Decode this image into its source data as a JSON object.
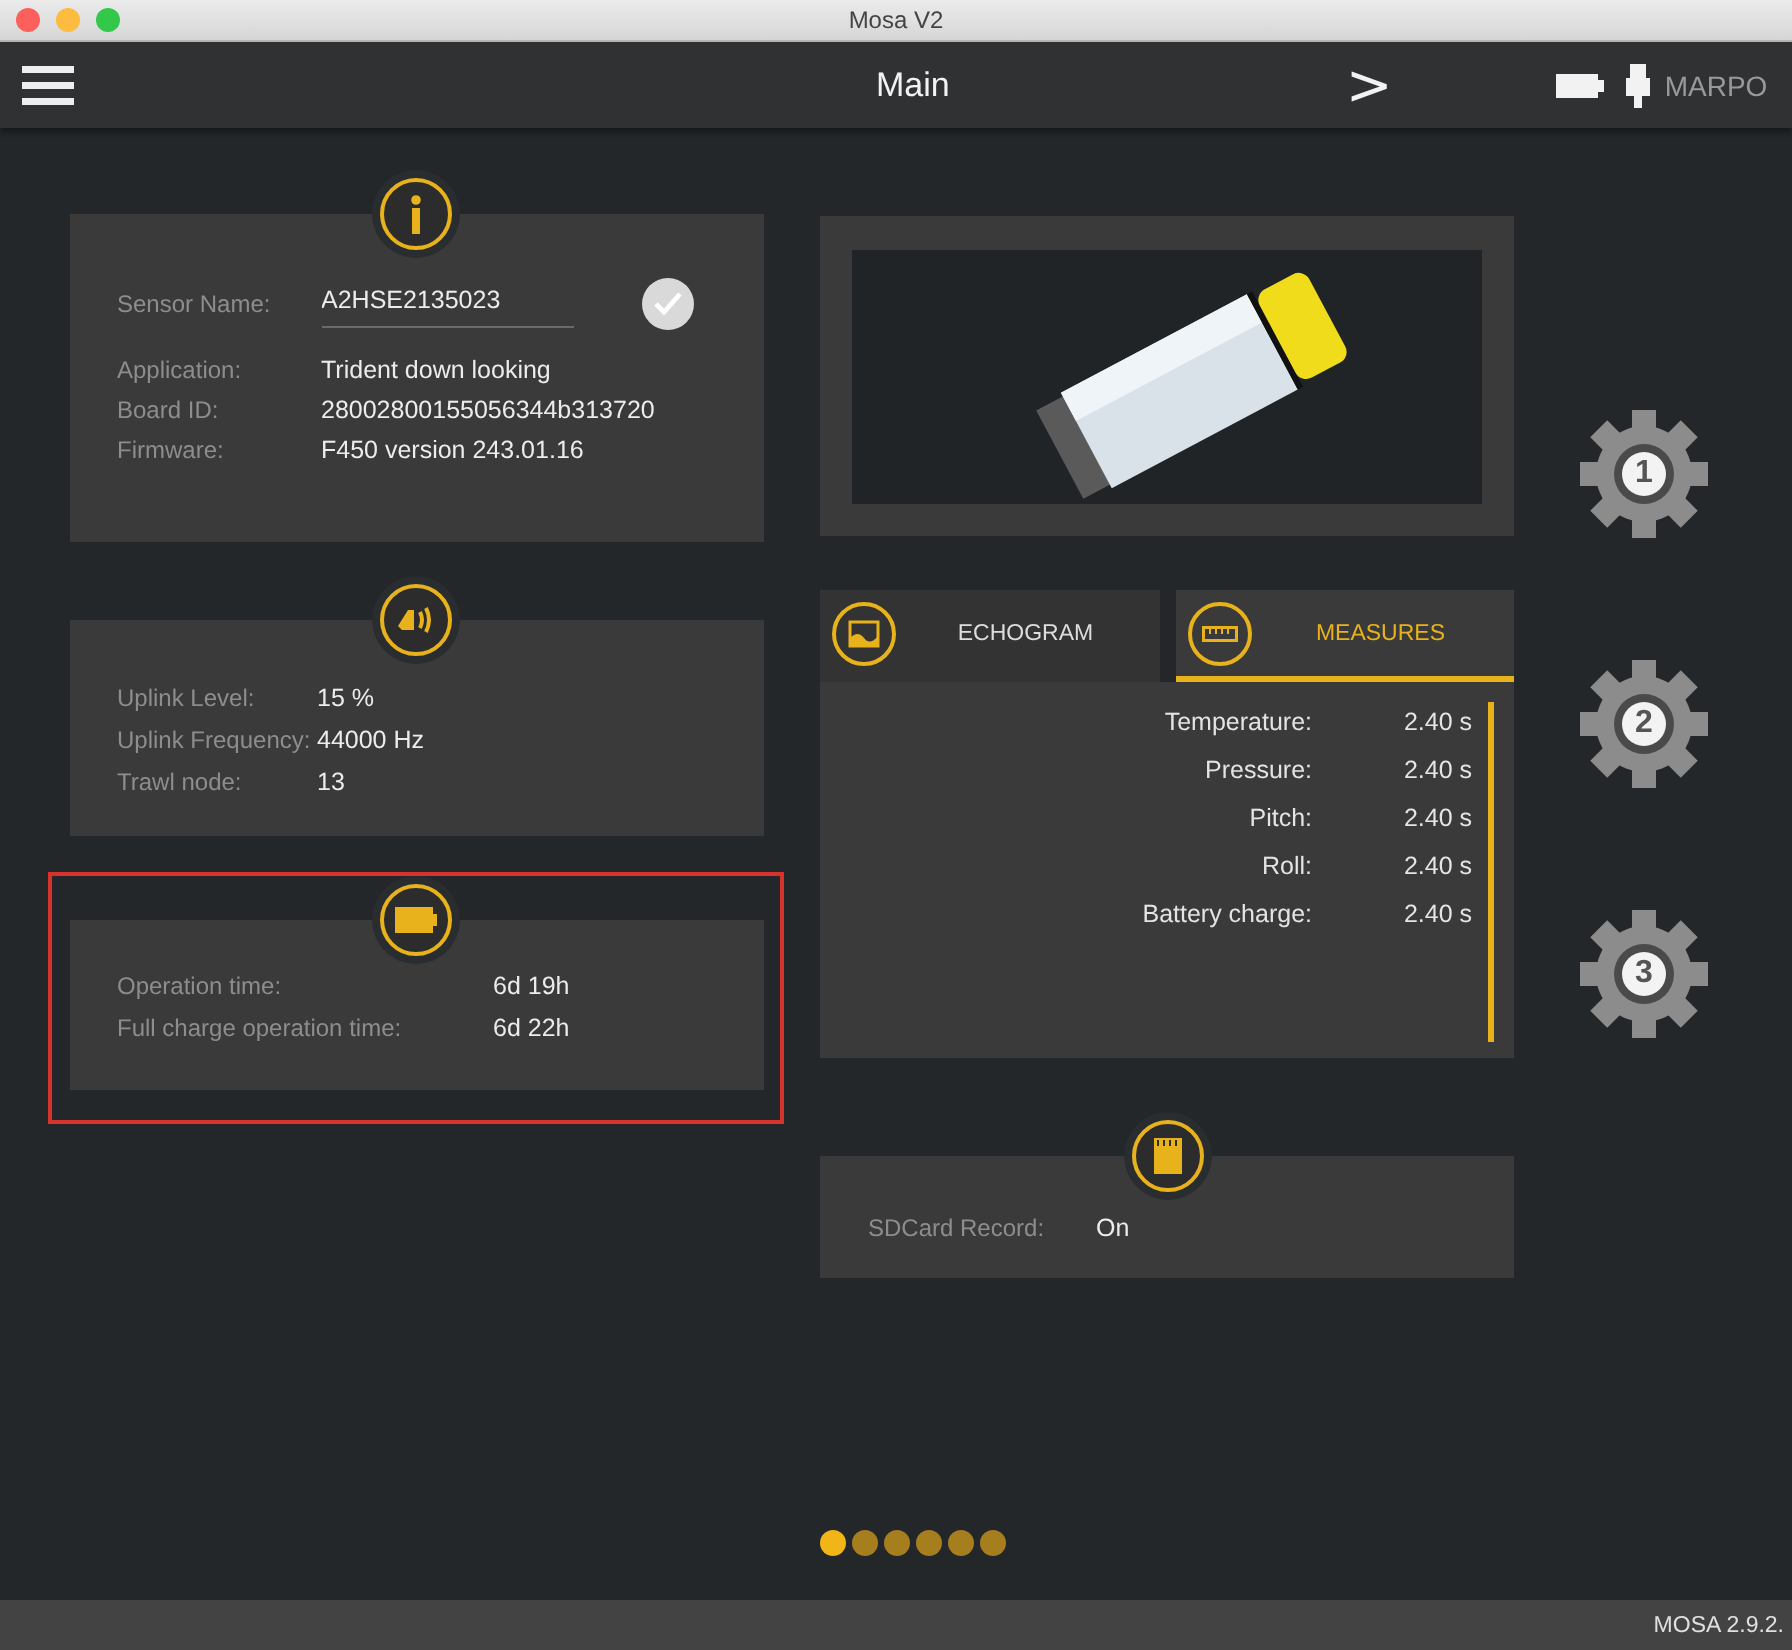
{
  "window": {
    "title": "Mosa V2"
  },
  "app_bar": {
    "title": "Main",
    "next": ">",
    "logo": "MARPO"
  },
  "info": {
    "sensor_name_label": "Sensor Name:",
    "sensor_name": "A2HSE2135023",
    "confirmed": true,
    "rows": [
      {
        "label": "Application:",
        "value": "Trident down looking"
      },
      {
        "label": "Board ID:",
        "value": "28002800155056344b313720"
      },
      {
        "label": "Firmware:",
        "value": "F450 version 243.01.16"
      }
    ]
  },
  "uplink": {
    "rows": [
      {
        "label": "Uplink Level:",
        "value": "15 %"
      },
      {
        "label": "Uplink Frequency:",
        "value": "44000 Hz"
      },
      {
        "label": "Trawl node:",
        "value": "13"
      }
    ]
  },
  "battery": {
    "highlighted": true,
    "rows": [
      {
        "label": "Operation time:",
        "value": "6d 19h"
      },
      {
        "label": "Full charge operation time:",
        "value": "6d 22h"
      }
    ]
  },
  "tabs": [
    {
      "label": "ECHOGRAM",
      "kind": "echogram",
      "selected": false
    },
    {
      "label": "MEASURES",
      "kind": "measures",
      "selected": true
    }
  ],
  "measures": [
    {
      "label": "Temperature:",
      "value": "2.40 s"
    },
    {
      "label": "Pressure:",
      "value": "2.40 s"
    },
    {
      "label": "Pitch:",
      "value": "2.40 s"
    },
    {
      "label": "Roll:",
      "value": "2.40 s"
    },
    {
      "label": "Battery charge:",
      "value": "2.40 s"
    }
  ],
  "sdcard": {
    "label": "SDCard Record:",
    "value": "On"
  },
  "gears": [
    "1",
    "2",
    "3"
  ],
  "pages": [
    {
      "selected": true
    },
    {
      "selected": false
    },
    {
      "selected": false
    },
    {
      "selected": false
    },
    {
      "selected": false
    },
    {
      "selected": false
    }
  ],
  "status_bar": {
    "version": "MOSA 2.9.2."
  }
}
